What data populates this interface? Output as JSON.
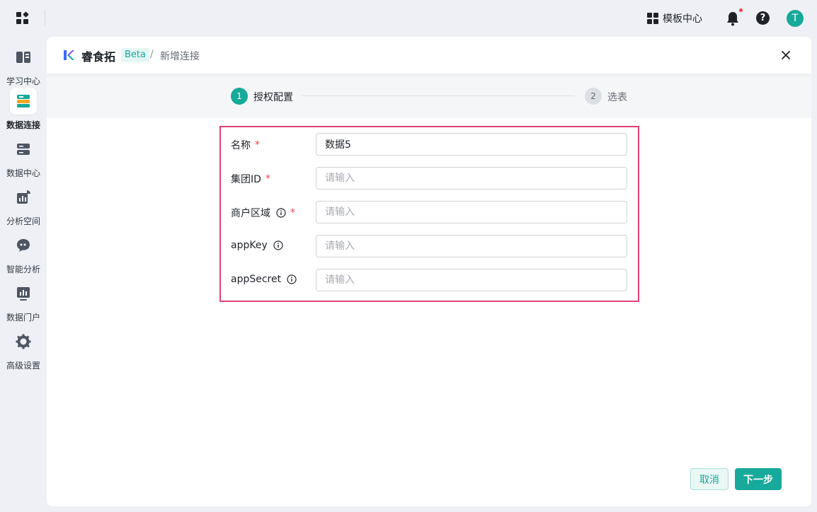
{
  "topbar": {
    "template_center_label": "模板中心",
    "avatar_initial": "T",
    "help_glyph": "?"
  },
  "sidebar": {
    "items": [
      {
        "label": "学习中心",
        "icon": "learning-center-icon",
        "active": false
      },
      {
        "label": "数据连接",
        "icon": "data-connection-icon",
        "active": true
      },
      {
        "label": "数据中心",
        "icon": "data-center-icon",
        "active": false
      },
      {
        "label": "分析空间",
        "icon": "analysis-space-icon",
        "active": false
      },
      {
        "label": "智能分析",
        "icon": "smart-analysis-icon",
        "active": false
      },
      {
        "label": "数据门户",
        "icon": "data-portal-icon",
        "active": false
      },
      {
        "label": "高级设置",
        "icon": "advanced-settings-icon",
        "active": false
      }
    ]
  },
  "header": {
    "brand_name": "睿食拓",
    "badge": "Beta",
    "separator": "/",
    "breadcrumb_current": "新增连接"
  },
  "steps": [
    {
      "number": "1",
      "label": "授权配置",
      "active": true
    },
    {
      "number": "2",
      "label": "选表",
      "active": false
    }
  ],
  "form": {
    "fields": [
      {
        "label": "名称",
        "required": true,
        "info": false,
        "value": "数据5",
        "placeholder": "请输入"
      },
      {
        "label": "集团ID",
        "required": true,
        "info": false,
        "value": "",
        "placeholder": "请输入"
      },
      {
        "label": "商户区域",
        "required": true,
        "info": true,
        "value": "",
        "placeholder": "请输入"
      },
      {
        "label": "appKey",
        "required": false,
        "info": true,
        "value": "",
        "placeholder": "请输入"
      },
      {
        "label": "appSecret",
        "required": false,
        "info": true,
        "value": "",
        "placeholder": "请输入"
      }
    ],
    "required_mark": "*"
  },
  "footer": {
    "cancel_label": "取消",
    "next_label": "下一步"
  },
  "colors": {
    "accent": "#17a999",
    "required": "#f23d4f",
    "highlight_border": "#e0407a"
  }
}
